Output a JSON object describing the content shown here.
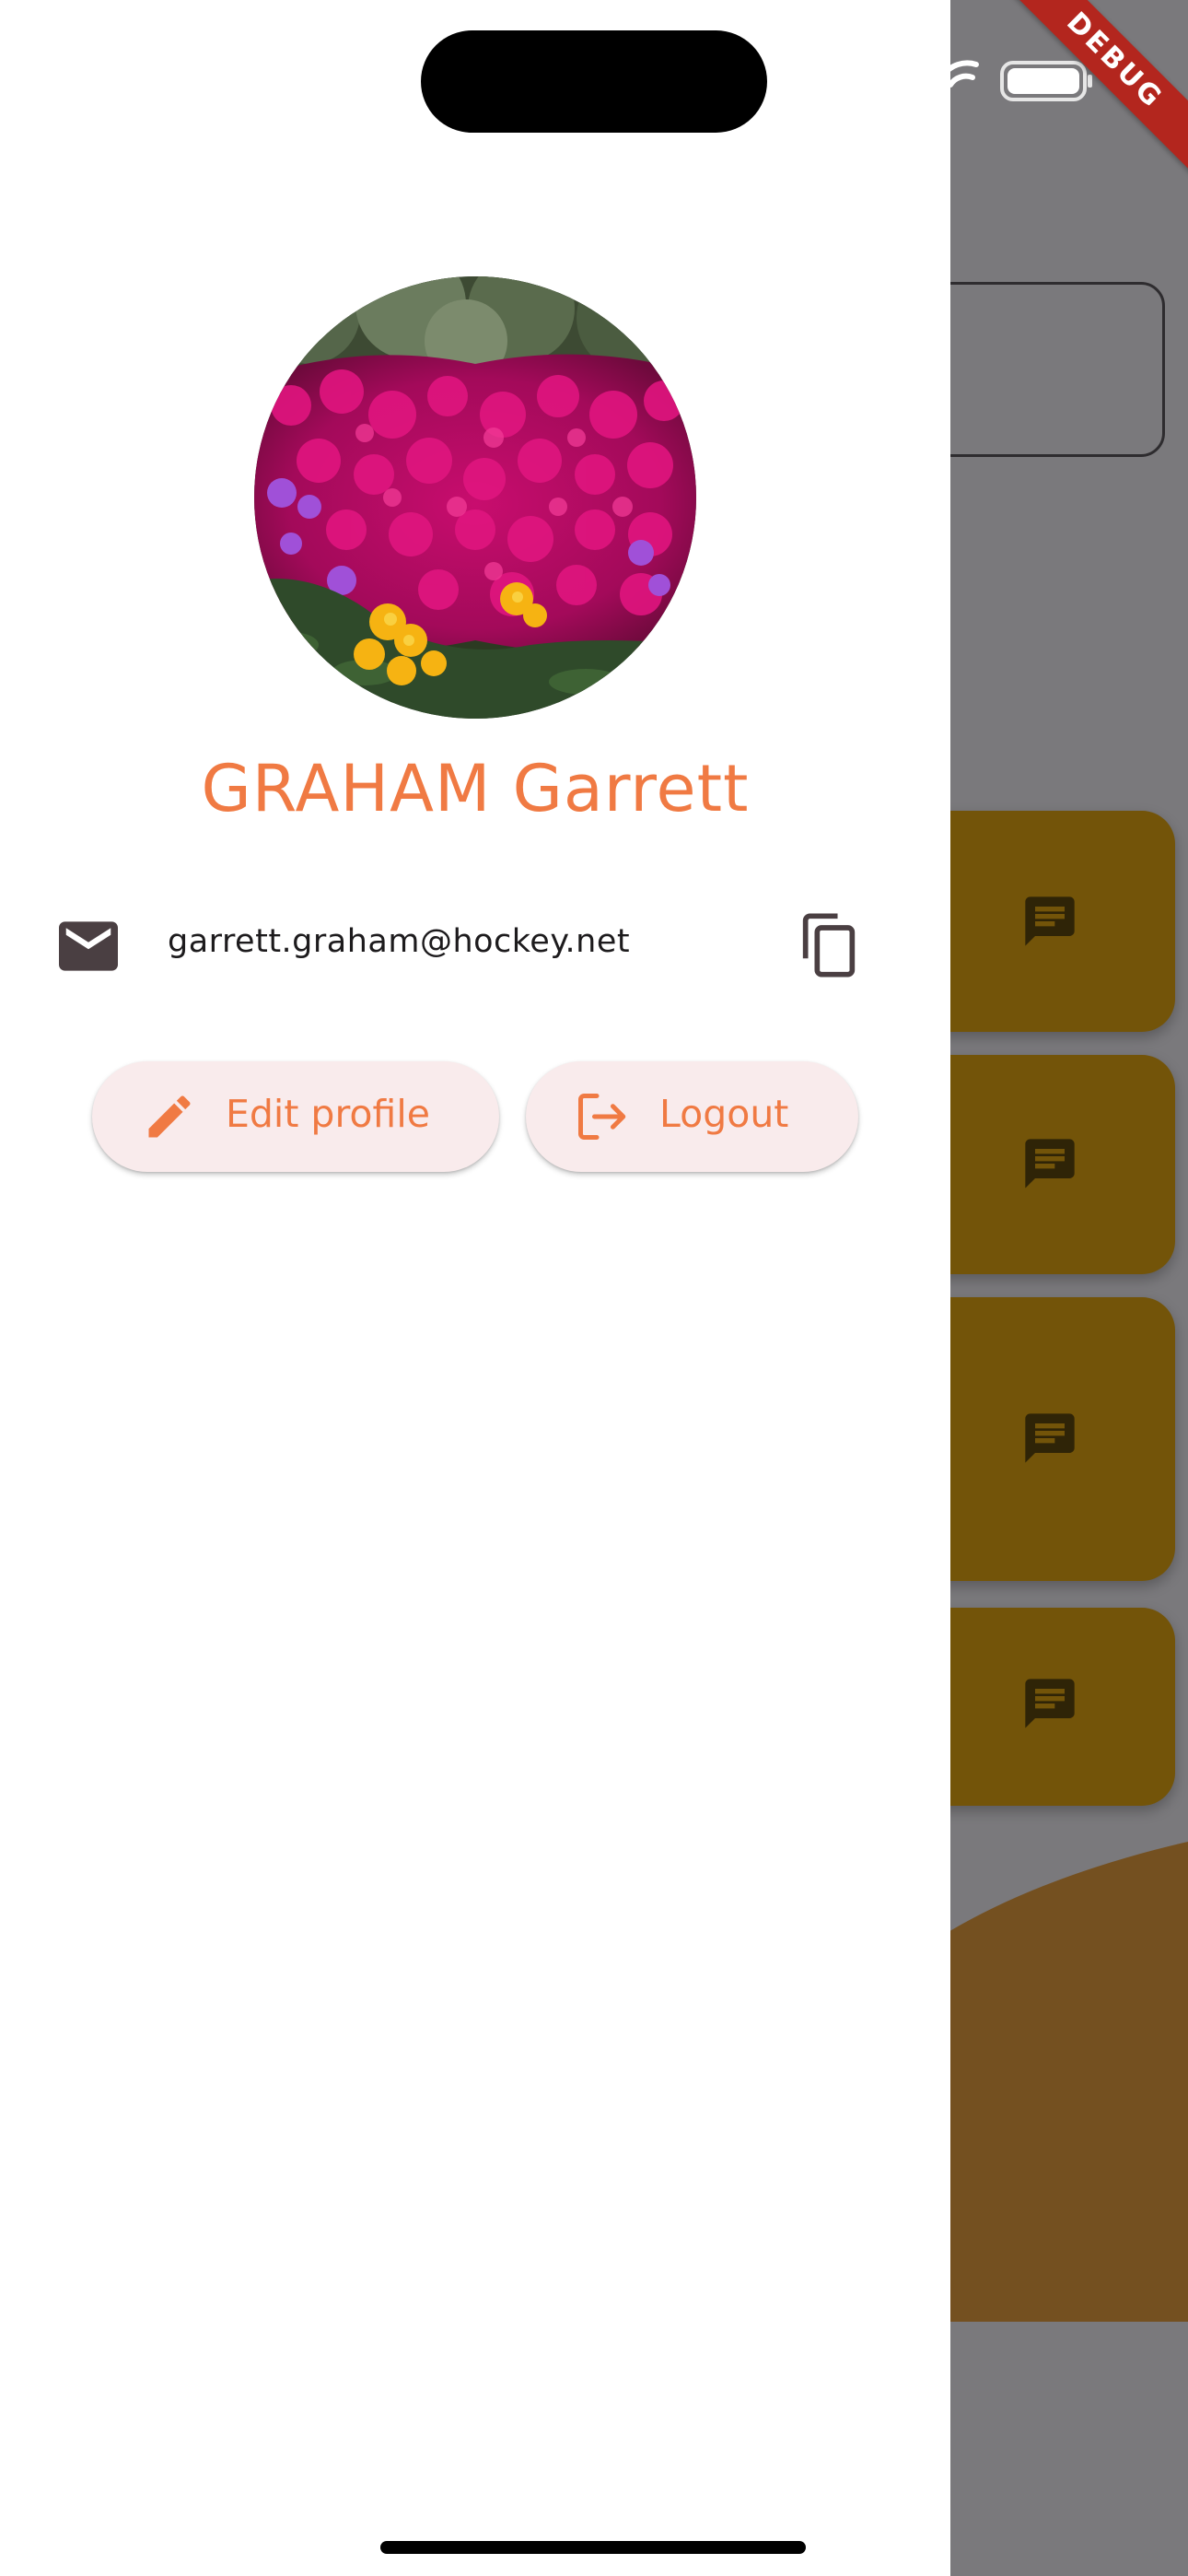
{
  "profile": {
    "name": "GRAHAM Garrett",
    "email": "garrett.graham@hockey.net",
    "avatar_icon": "flower-garden-photo"
  },
  "actions": {
    "edit_label": "Edit profile",
    "logout_label": "Logout"
  },
  "icons": {
    "email": "mail-icon",
    "copy": "copy-icon",
    "edit": "pencil-icon",
    "logout": "logout-icon",
    "chat": "chat-icon"
  },
  "system": {
    "debug_banner": "DEBUG"
  },
  "colors": {
    "accent": "#f07a43",
    "button_bg": "#f9ebec",
    "card_bg": "#735409",
    "scrim": "#7a797c"
  }
}
